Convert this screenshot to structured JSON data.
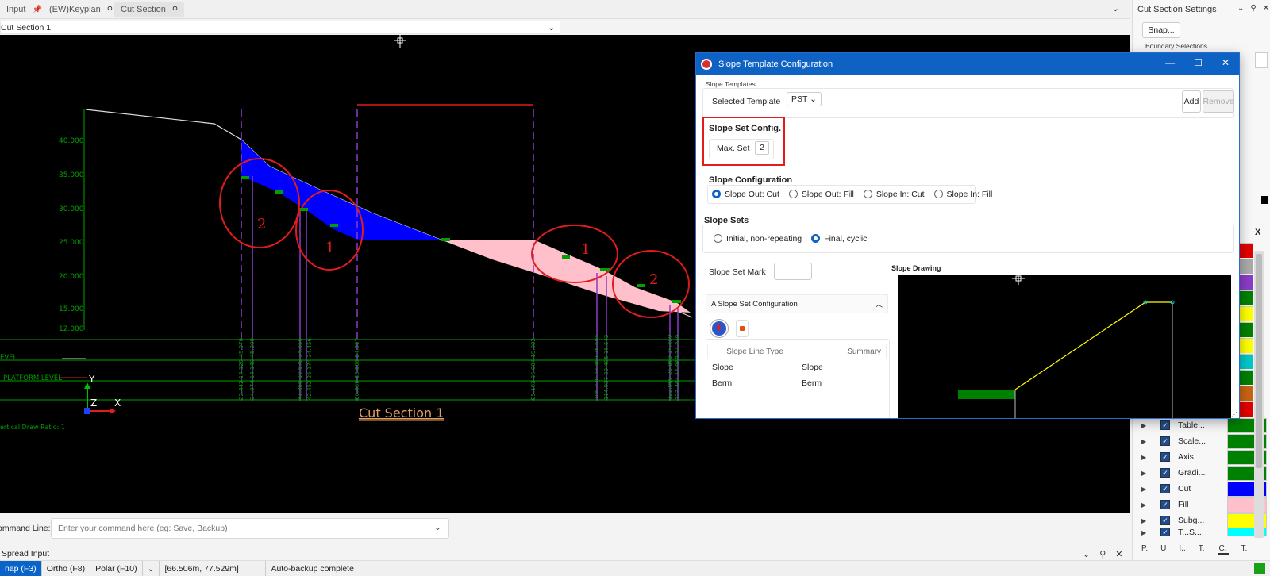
{
  "tabs": [
    {
      "label": "Input"
    },
    {
      "label": "(EW)Keyplan"
    },
    {
      "label": "Cut Section"
    }
  ],
  "sheet_select": {
    "value": "Cut Section 1"
  },
  "canvas": {
    "elevations": [
      "40.000",
      "35.000",
      "30.000",
      "25.000",
      "20.000",
      "15.000",
      "12.000"
    ],
    "level_labels": [
      "EVEL",
      "PLATFORM LEVEL"
    ],
    "axis_y": "Y",
    "axis_x": "X",
    "axis_z": "Z",
    "section_title": "Cut Section 1",
    "draw_ratio": "ertical Draw Ratio: 1",
    "annotation_numbers": [
      "2",
      "1",
      "1",
      "2"
    ],
    "station_labels": [
      "32.442 14.128 45.070",
      "34.074 14.149 45.209",
      "41.850 10.578 34.656",
      "42.452 26.174 34.456",
      "50.469 33.006 24.097",
      "95.103 36.004 19.982",
      "106.230 28.469 16.694",
      "114.937 30.405 16.542",
      "122.969 26.869 14.459",
      "123.404 15.969 14.249"
    ],
    "colors": {
      "cut": "#0000ff",
      "fill": "#ffc0cb",
      "grid": "#00a000",
      "annotation": "#e01c1c",
      "title": "#e0a060"
    }
  },
  "command_line": {
    "label": "ommand Line:",
    "placeholder": "Enter your command here (eg: Save, Backup)"
  },
  "spread_input": {
    "label": "Spread Input"
  },
  "status_bar": {
    "snap": "nap (F3)",
    "ortho": "Ortho (F8)",
    "polar": "Polar (F10)",
    "coords": "[66.506m, 77.529m]",
    "message": "Auto-backup complete"
  },
  "right_panel": {
    "title": "Cut Section Settings",
    "snap_button": "Snap...",
    "boundary_label": "Boundary Selections",
    "close_label": "X",
    "layers": [
      {
        "name": "Table...",
        "color": "#008000"
      },
      {
        "name": "Scale...",
        "color": "#008000"
      },
      {
        "name": "Axis",
        "color": "#008000"
      },
      {
        "name": "Gradi...",
        "color": "#008000"
      },
      {
        "name": "Cut",
        "color": "#0000ff"
      },
      {
        "name": "Fill",
        "color": "#ffc0cb"
      },
      {
        "name": "Subg...",
        "color": "#ffff00"
      },
      {
        "name": "T...S...",
        "color": "#00ffff"
      }
    ],
    "swatch_column": [
      "#e00000",
      "#aaaaaa",
      "#8a3cc8",
      "#008000",
      "#ffff00",
      "#008000",
      "#ffff00",
      "#00c8c8",
      "#008000",
      "#c86414",
      "#e00000"
    ],
    "bottom_tabs": [
      "P.",
      "U",
      "I..",
      "T.",
      "C.",
      "T."
    ]
  },
  "dialog": {
    "title": "Slope Template Configuration",
    "slope_templates_label": "Slope Templates",
    "selected_template_label": "Selected Template",
    "selected_template_value": "PST",
    "add_button": "Add",
    "remove_button": "Remove",
    "slope_set_config_label": "Slope Set Config.",
    "max_set_label": "Max. Set",
    "max_set_value": "2",
    "slope_configuration_label": "Slope Configuration",
    "slope_config_options": [
      {
        "label": "Slope Out: Cut",
        "selected": true
      },
      {
        "label": "Slope Out: Fill",
        "selected": false
      },
      {
        "label": "Slope In: Cut",
        "selected": false
      },
      {
        "label": "Slope In: Fill",
        "selected": false
      }
    ],
    "slope_sets_label": "Slope Sets",
    "slope_set_options": [
      {
        "label": "Initial, non-repeating",
        "selected": false
      },
      {
        "label": "Final, cyclic",
        "selected": true
      }
    ],
    "slope_set_mark_label": "Slope Set Mark",
    "slope_set_mark_value": "",
    "a_slope_set_config_label": "A Slope Set Configuration",
    "table_headers": [
      "Slope Line Type",
      "Summary"
    ],
    "table_rows": [
      [
        "Slope",
        "Slope"
      ],
      [
        "Berm",
        "Berm"
      ]
    ],
    "slope_drawing_label": "Slope Drawing"
  }
}
